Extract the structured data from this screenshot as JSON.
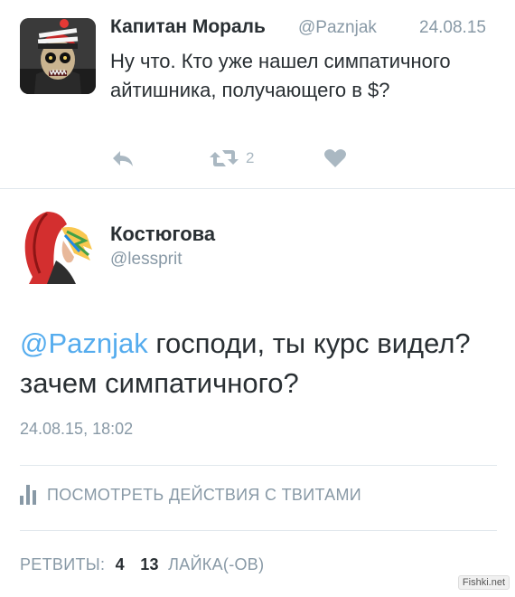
{
  "tweet1": {
    "author_name": "Капитан Мораль",
    "handle": "@Paznjak",
    "date": "24.08.15",
    "text": "Ну что. Кто уже нашел симпатичного айтишника, получающего в $?",
    "retweet_count": "2",
    "icons": {
      "reply": "reply-icon",
      "retweet": "retweet-icon",
      "like": "heart-icon"
    }
  },
  "tweet2": {
    "author_name": "Костюгова",
    "handle": "@lessprit",
    "mention": "@Paznjak",
    "text": " господи, ты курс видел? зачем симпатичного?",
    "timestamp": "24.08.15, 18:02",
    "activity_label": "ПОСМОТРЕТЬ ДЕЙСТВИЯ С ТВИТАМИ",
    "retweets_label": "РЕТВИТЫ:",
    "retweets_value": "4",
    "likes_value": "13",
    "likes_label": "ЛАЙКА(-ОВ)"
  },
  "watermark": "Fishki.net",
  "colors": {
    "link": "#55acee",
    "muted": "#8899a6",
    "icon": "#aab8c2",
    "text": "#292f33",
    "divider": "#e1e8ed"
  }
}
